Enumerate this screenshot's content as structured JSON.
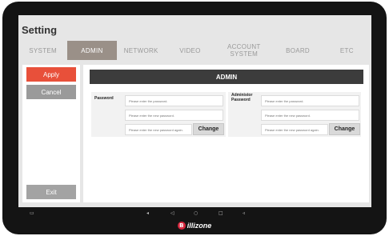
{
  "app": {
    "title": "Setting"
  },
  "tabs": [
    {
      "label": "SYSTEM"
    },
    {
      "label": "ADMIN",
      "active": true
    },
    {
      "label": "NETWORK"
    },
    {
      "label": "VIDEO"
    },
    {
      "label": "ACCOUNT SYSTEM"
    },
    {
      "label": "BOARD"
    },
    {
      "label": "ETC"
    }
  ],
  "sidebar": {
    "apply_label": "Apply",
    "cancel_label": "Cancel",
    "exit_label": "Exit"
  },
  "panel": {
    "title": "ADMIN",
    "password_group": {
      "label": "Password",
      "current_placeholder": "Please enter the password.",
      "new_placeholder": "Please enter the new password.",
      "confirm_placeholder": "Please enter the new password again.",
      "change_label": "Change"
    },
    "admin_password_group": {
      "label": "Administor Password",
      "current_placeholder": "Please enter the password.",
      "new_placeholder": "Please enter the new password.",
      "confirm_placeholder": "Please enter the new password again.",
      "change_label": "Change"
    }
  },
  "device": {
    "brand_mark": "B",
    "brand_name": "illizone",
    "nav_icons": [
      "screenshot-icon",
      "volume-down-icon",
      "back-icon",
      "home-icon",
      "recents-icon",
      "volume-up-icon"
    ]
  },
  "colors": {
    "accent": "#e8503a",
    "active_tab": "#9a9088",
    "header_bar": "#3c3c3c",
    "brand": "#d7263d"
  }
}
